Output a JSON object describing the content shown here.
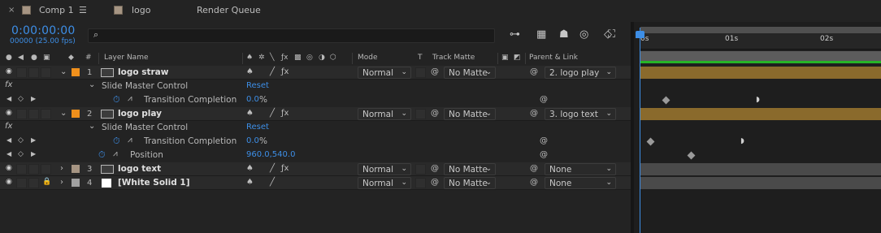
{
  "tabs": [
    {
      "label": "Comp 1",
      "active": true
    },
    {
      "label": "logo",
      "active": false
    },
    {
      "label": "Render Queue",
      "active": false
    }
  ],
  "header": {
    "timecode": "0:00:00:00",
    "frames": "00000 (25.00 fps)",
    "search_placeholder": "",
    "search_icon": "⌕"
  },
  "columns": {
    "num": "#",
    "layer_name": "Layer Name",
    "mode": "Mode",
    "t": "T",
    "track_matte": "Track Matte",
    "parent_link": "Parent & Link"
  },
  "layers": [
    {
      "num": "1",
      "name": "logo straw",
      "label_color": "#f0901c",
      "mode": "Normal",
      "matte": "No Matte",
      "parent": "2. logo play"
    },
    {
      "num": "2",
      "name": "logo play",
      "label_color": "#f0901c",
      "mode": "Normal",
      "matte": "No Matte",
      "parent": "3. logo text"
    },
    {
      "num": "3",
      "name": "logo text",
      "label_color": "#a69583",
      "mode": "Normal",
      "matte": "No Matte",
      "parent": "None"
    },
    {
      "num": "4",
      "name": "[White Solid 1]",
      "label_color": "#a0a0a0",
      "mode": "Normal",
      "matte": "No Matte",
      "parent": "None"
    }
  ],
  "props": {
    "fx": "fx",
    "slide_master_control": "Slide Master Control",
    "reset": "Reset",
    "transition_completion": "Transition Completion",
    "transition_value": "0.0",
    "transition_unit": "%",
    "position": "Position",
    "position_value": "960.0,540.0"
  },
  "timeline": {
    "ruler_labels": [
      "0s",
      "01s",
      "02s"
    ],
    "layer_bar_color": "#8a6a2c",
    "dark_bar_color": "#4a4a4a",
    "current_time_color": "#3d8ee6"
  }
}
